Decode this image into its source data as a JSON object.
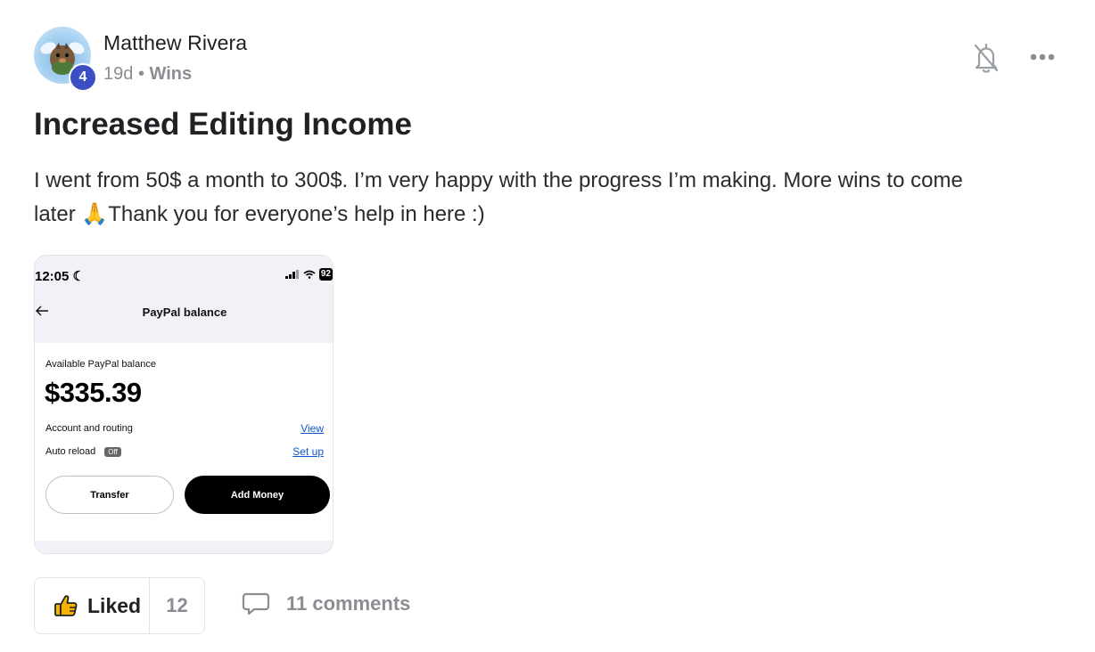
{
  "post": {
    "author": "Matthew Rivera",
    "level": "4",
    "age": "19d",
    "separator": "•",
    "category": "Wins",
    "title": "Increased Editing Income",
    "body_line1": "I went from 50$ a month to 300$. I’m very happy with the progress I’m making. More wins to come",
    "body_line2_pre": "later ",
    "body_emoji": "🙏",
    "body_line2_post": "Thank you for everyone’s help in here :)",
    "icons": {
      "avatar": "avatar-icon",
      "notify": "bell-off-icon",
      "more": "more-dots-icon"
    }
  },
  "attachment": {
    "status_time": "12:05",
    "battery": "92",
    "header_title": "PayPal balance",
    "available_label": "Available PayPal balance",
    "amount": "$335.39",
    "account_label": "Account and routing",
    "view_link": "View",
    "auto_reload_label": "Auto reload",
    "auto_reload_state": "Off",
    "setup_link": "Set up",
    "transfer_label": "Transfer",
    "add_money_label": "Add Money"
  },
  "actions": {
    "liked_label": "Liked",
    "like_count": "12",
    "comments_label": "11 comments",
    "icons": {
      "like": "thumbs-up-icon",
      "comment": "comment-bubble-icon"
    }
  },
  "colors": {
    "level_badge": "#3b4fc2",
    "link_blue": "#0b57d0",
    "muted_text": "#8a8d91"
  }
}
